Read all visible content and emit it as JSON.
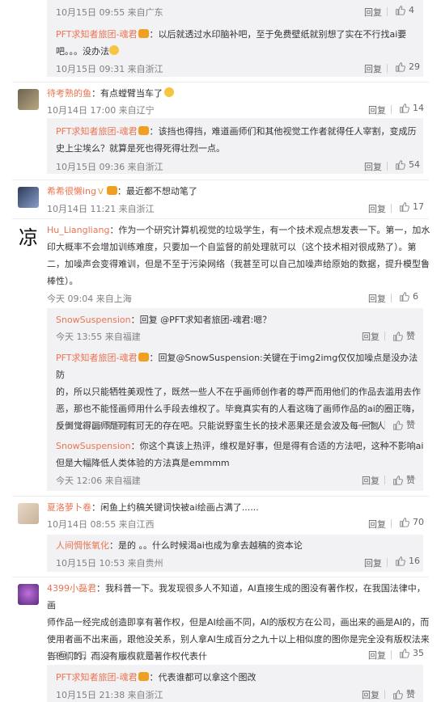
{
  "c0": {
    "time": "10月15日 09:55 来自广东",
    "reply": "回复",
    "likes": "4"
  },
  "c1": {
    "name": "PFT求知者旅团-魂君",
    "text1": "：以后就透过水印脑补吧，至于免费壁纸就别想了实在不行找ai要",
    "text2": "吧。。。没办法",
    "time": "10月15日 09:31 来自浙江",
    "reply": "回复",
    "likes": "29"
  },
  "c2": {
    "name": "待考熟的鱼",
    "text": "：有点螳臂当车了",
    "time": "10月14日 17:00 来自辽宁",
    "reply": "回复",
    "likes": "14"
  },
  "c3": {
    "name": "PFT求知者旅团-魂君",
    "text1": "：该挡也得挡，难道画师们和其他视觉工作者就得任人宰割，变成历",
    "text2": "史上尘埃么？就算是死也得死得壮烈一点。",
    "time": "10月15日 09:36 来自浙江",
    "reply": "回复",
    "likes": "54"
  },
  "c4": {
    "name": "希希很懒ing",
    "text": "：最近都不想动笔了",
    "time": "10月14日 11:21 来自浙江",
    "reply": "回复",
    "likes": "17"
  },
  "c5": {
    "avatar_char": "凉",
    "name": "Hu_Liangliang",
    "text1": "：作为一个研究计算机视觉的垃圾学生，有一个技术观点想发表一下。第一，加水",
    "text2": "印大概率不会增加训练难度，只要加一个自监督的前处理就可以（这个技术相对很成熟了）。第",
    "text3": "二，加噪声会变得难训，但是不至于污染网络（我甚至可以自己加噪声给原始的数据，提升模型鲁",
    "text4": "棒性）。",
    "time": "今天 09:04 来自上海",
    "reply": "回复",
    "likes": "6"
  },
  "c6": {
    "name": "SnowSuspension",
    "text": "：回复 @PFT求知者旅团-魂君:嗯？",
    "time": "今天 13:55 来自福建",
    "reply": "回复",
    "likes": "赞"
  },
  "c7": {
    "name": "PFT求知者旅团-魂君",
    "text1": "：回复@SnowSuspension:关键在于img2img仅仅加噪点是没办法防",
    "text2": "的，所以只能牺牲美观性了，既然一些人不在乎画师创作者的尊严而用他们的作品去滥用去作",
    "text3": "恶，那也不能怪画师用什么手段去维权了。毕竟真实有的人看这嗨了画师作品的ai的圈正嗨，",
    "text4": "反倒觉得画师是可有可无的存在吧。只能说野蛮生长的技术恶果还是会波及每一个人",
    "time": "今天 12:16 来自浙江",
    "reply": "回复",
    "likes": "赞"
  },
  "c8": {
    "name": "SnowSuspension",
    "text1": "：你这个真该上热评，维权是好事，但是得有合适的方法吧，这种不影响ai",
    "text2": "但是大幅降低人类体验的方法真是emmmm",
    "time": "今天 12:06 来自福建",
    "reply": "回复",
    "likes": "赞"
  },
  "c9": {
    "name": "夏洛萝卜卷",
    "text": "：闲鱼上约稿关键词快被ai绘画占满了......",
    "time": "10月14日 08:55 来自江西",
    "reply": "回复",
    "likes": "70"
  },
  "c10": {
    "name": "人间惆怅氧化",
    "text": "：是的 。。什么时候渴ai也成为拿去越稿的资本论",
    "time": "10月15日 10:53 来自贵州",
    "reply": "回复",
    "likes": "16"
  },
  "c11": {
    "name": "4399小磊君",
    "text1": "：我科普一下。我发现很多人不知道，AI直接生成的图没有著作权，在我国法律中，画",
    "text2": "师作品一经完成创造即享有著作权，但是AI绘画不同，AI的版权方在公司，画出来的画是AI的，而",
    "text3": "使用者画不出来画，跟他没关系，别人拿AI生成百分之九十以上相似度的图你是完全没有版权法来",
    "text4": "告他们的，而没有版权就是著作权代表什",
    "time": "10月15日 21:32 来自广西",
    "reply": "回复",
    "likes": "35"
  },
  "c12": {
    "name": "PFT求知者旅团-魂君",
    "text": "：代表谁都可以拿这个图改",
    "time": "10月15日 21:38 来自浙江",
    "reply": "回复",
    "likes": "赞"
  }
}
